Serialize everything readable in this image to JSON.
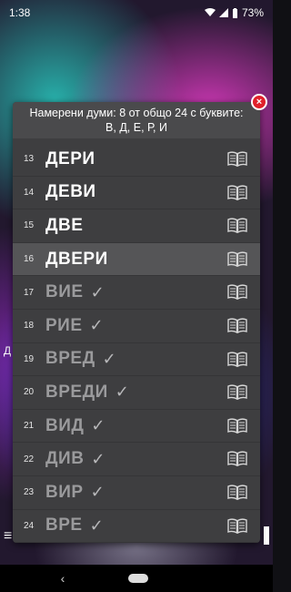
{
  "status": {
    "time": "1:38",
    "battery": "73%"
  },
  "background": {
    "left_label": "Д",
    "menu_icon": "≡"
  },
  "dialog": {
    "header_line1": "Намерени думи: 8 от общо 24 с буквите:",
    "header_line2": "В, Д, Е, Р, И",
    "rows": [
      {
        "num": "13",
        "word": "ДЕРИ",
        "checked": false
      },
      {
        "num": "14",
        "word": "ДЕВИ",
        "checked": false
      },
      {
        "num": "15",
        "word": "ДВЕ",
        "checked": false
      },
      {
        "num": "16",
        "word": "ДВЕРИ",
        "checked": false
      },
      {
        "num": "17",
        "word": "ВИЕ",
        "checked": true
      },
      {
        "num": "18",
        "word": "РИЕ",
        "checked": true
      },
      {
        "num": "19",
        "word": "ВРЕД",
        "checked": true
      },
      {
        "num": "20",
        "word": "ВРЕДИ",
        "checked": true
      },
      {
        "num": "21",
        "word": "ВИД",
        "checked": true
      },
      {
        "num": "22",
        "word": "ДИВ",
        "checked": true
      },
      {
        "num": "23",
        "word": "ВИР",
        "checked": true
      },
      {
        "num": "24",
        "word": "ВРЕ",
        "checked": true
      }
    ],
    "check_mark": "✓",
    "close_symbol": "×"
  },
  "icons": {
    "book": "book-icon",
    "close": "close-icon",
    "check": "check-icon"
  }
}
